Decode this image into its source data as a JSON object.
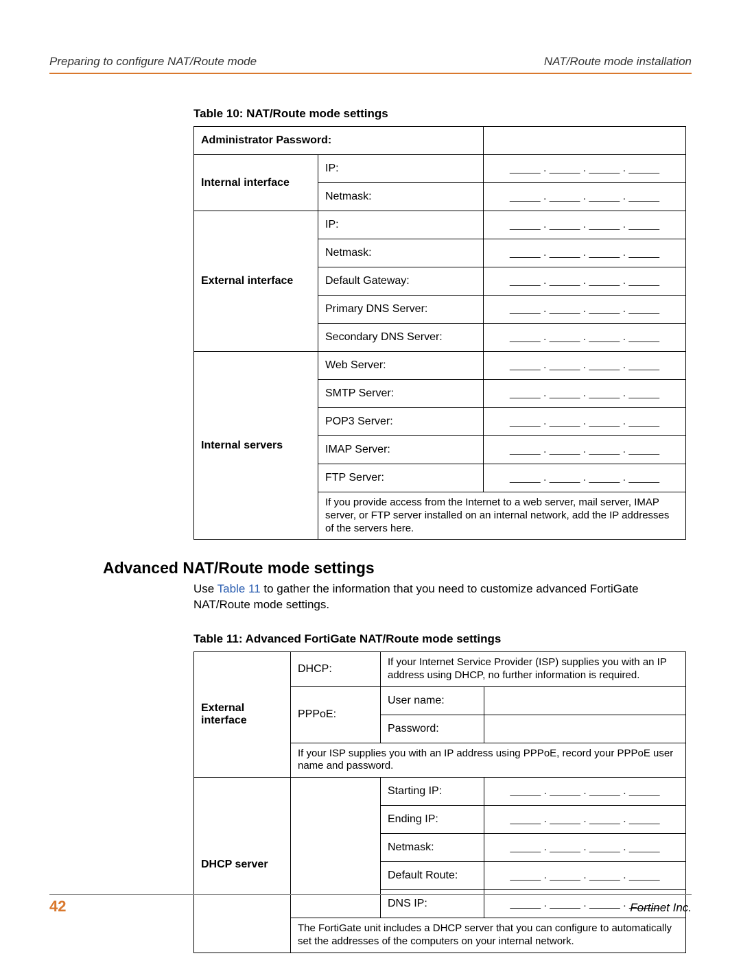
{
  "header": {
    "left": "Preparing to configure NAT/Route mode",
    "right": "NAT/Route mode installation"
  },
  "table10": {
    "caption": "Table 10: NAT/Route mode settings",
    "rows": {
      "admin_pw": "Administrator Password:",
      "internal_if": "Internal interface",
      "external_if": "External interface",
      "internal_servers": "Internal servers",
      "ip": "IP:",
      "netmask": "Netmask:",
      "default_gw": "Default Gateway:",
      "primary_dns": "Primary DNS Server:",
      "secondary_dns": "Secondary DNS Server:",
      "web_server": "Web Server:",
      "smtp": "SMTP Server:",
      "pop3": "POP3 Server:",
      "imap": "IMAP Server:",
      "ftp": "FTP Server:",
      "servers_note": "If you provide access from the Internet to a web server, mail server, IMAP server, or FTP server installed on an internal network, add the IP addresses of the servers here."
    },
    "blank": "_____ . _____ . _____ . _____"
  },
  "section_heading": "Advanced NAT/Route mode settings",
  "body_para_pre": "Use ",
  "body_para_link": "Table 11",
  "body_para_post": " to gather the information that you need to customize advanced FortiGate NAT/Route mode settings.",
  "table11": {
    "caption": "Table 11: Advanced FortiGate NAT/Route mode settings",
    "external_if": "External interface",
    "dhcp": "DHCP:",
    "dhcp_desc": "If your Internet Service Provider (ISP) supplies you with an IP address using DHCP, no further information is required.",
    "pppoe": "PPPoE:",
    "username": "User name:",
    "password": "Password:",
    "pppoe_note": "If your ISP supplies you with an IP address using PPPoE, record your PPPoE user name and password.",
    "dhcp_server": "DHCP server",
    "starting_ip": "Starting IP:",
    "ending_ip": "Ending IP:",
    "netmask": "Netmask:",
    "default_route": "Default Route:",
    "dns_ip": "DNS IP:",
    "dhcp_note": "The FortiGate unit includes a DHCP server that you can configure to automatically set the addresses of the computers on your internal network.",
    "blank": "_____ . _____ . _____ . _____"
  },
  "footer": {
    "page": "42",
    "right": "Fortinet Inc."
  }
}
